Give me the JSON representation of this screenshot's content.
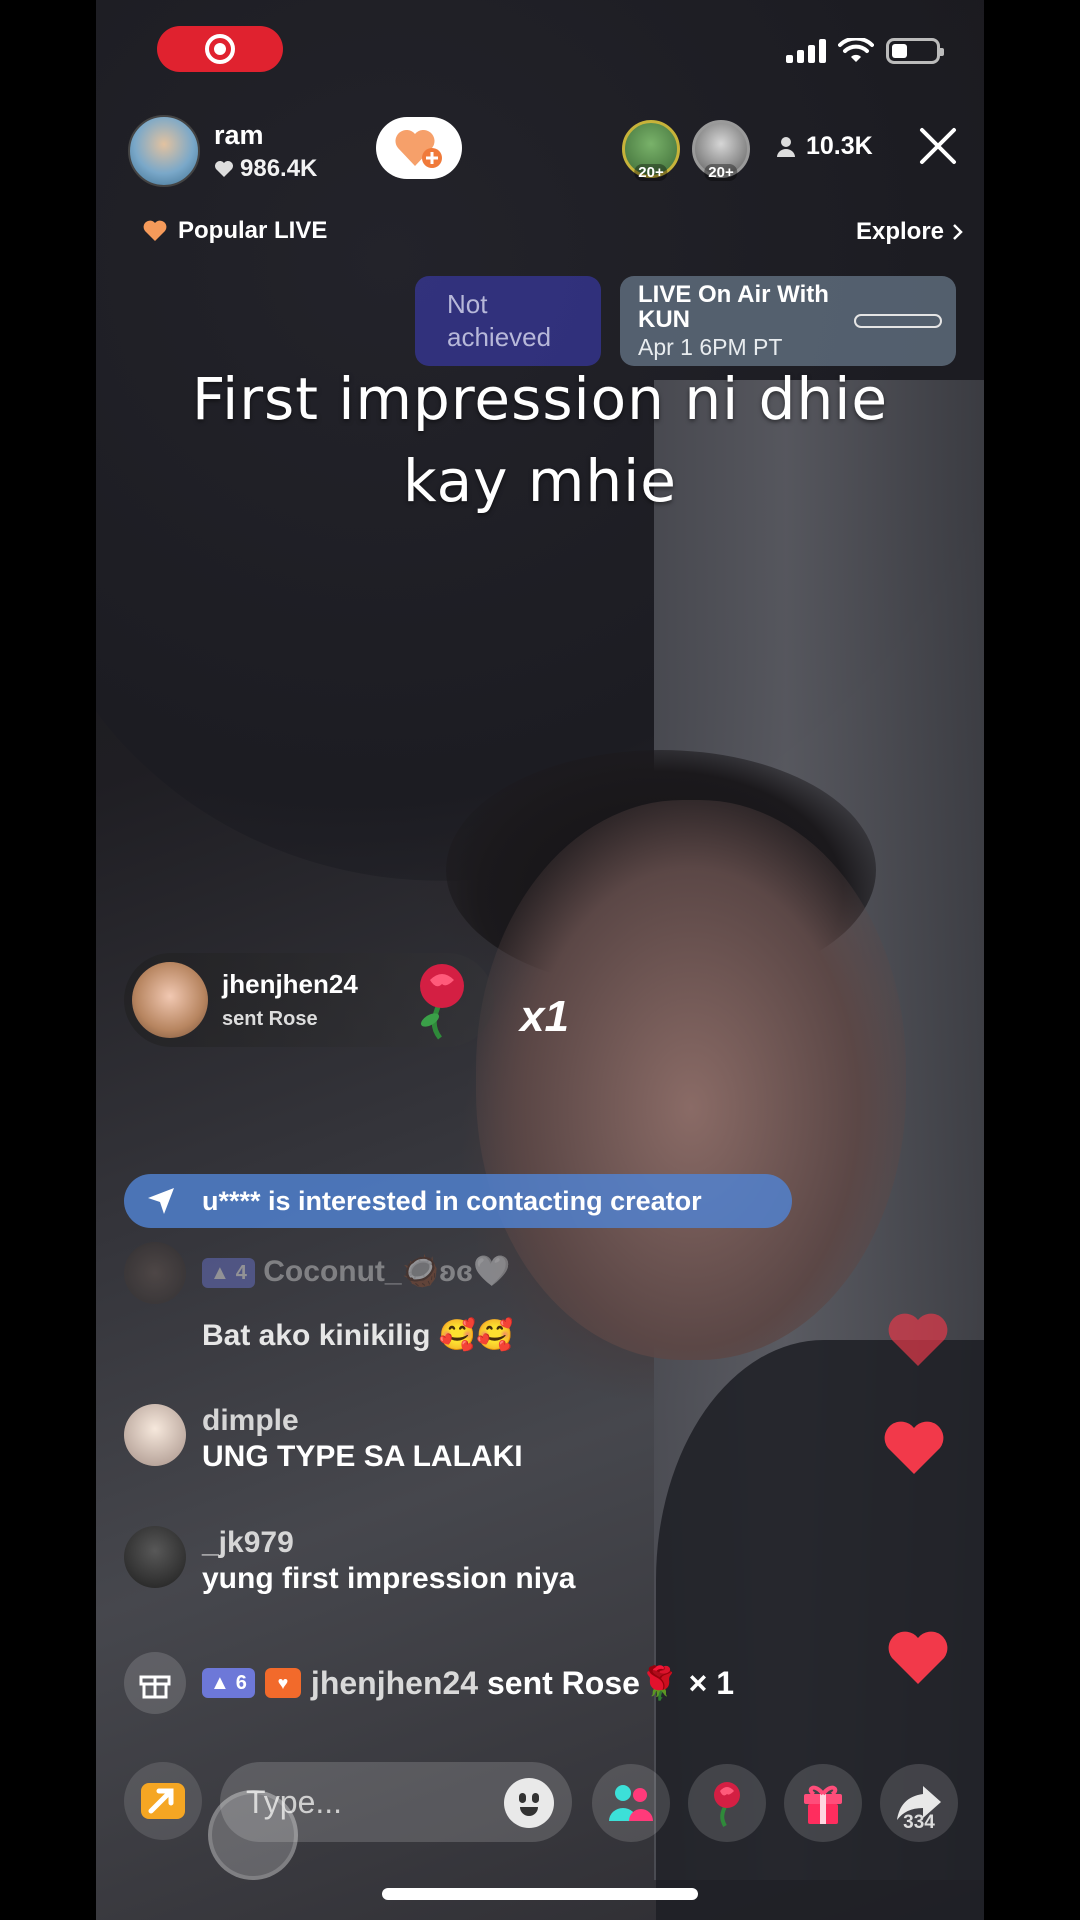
{
  "host": {
    "name": "ram",
    "likes": "986.4K"
  },
  "viewers": {
    "badge_1": "20+",
    "badge_2": "20+",
    "count": "10.3K"
  },
  "nav": {
    "popular_label": "Popular LIVE",
    "explore_label": "Explore"
  },
  "goal": {
    "status": "Not achieved"
  },
  "event": {
    "title": "LIVE On Air With KUN",
    "date": "Apr 1 6PM PT"
  },
  "caption": "First impression ni dhie kay mhie",
  "gift_banner": {
    "user": "jhenjhen24",
    "subtitle": "sent Rose",
    "count": "x1"
  },
  "notice": "u**** is interested in contacting creator",
  "comments": [
    {
      "level": "4",
      "name": "Coconut_🥥ʚɞ🤍",
      "text": ""
    },
    {
      "name": "",
      "text": "Bat ako kinikilig 🥰🥰"
    },
    {
      "name": "dimple",
      "text": "UNG TYPE SA LALAKI"
    },
    {
      "name": "_jk979",
      "text": "yung first impression niya"
    }
  ],
  "gift_log": {
    "level": "6",
    "user": "jhenjhen24",
    "action": "sent Rose🌹 × 1"
  },
  "input": {
    "placeholder": "Type..."
  },
  "share_count": "334",
  "colors": {
    "record": "#e0222f",
    "notice_bg": "#5082d2",
    "heart": "#f2394a",
    "level_badge": "#6d78d8"
  }
}
